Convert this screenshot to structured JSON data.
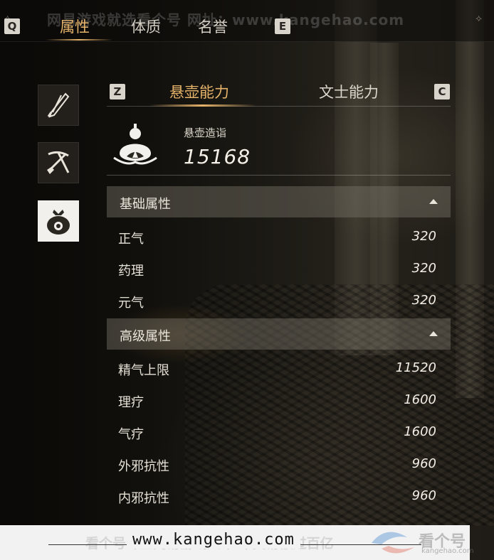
{
  "top_tabs": {
    "left_key": "Q",
    "right_key": "E",
    "items": [
      "属性",
      "体质",
      "名誉"
    ],
    "active_index": 0
  },
  "watermark_top": "网易游戏就选看个号  网址：www.kangehao.com",
  "side_icons": [
    "sword-tool-icon",
    "shovel-pickaxe-icon",
    "pouch-icon"
  ],
  "sub_tabs": {
    "left_key": "Z",
    "right_key": "C",
    "items": [
      "悬壶能力",
      "文士能力"
    ],
    "active_index": 0
  },
  "skill": {
    "label": "悬壶造诣",
    "value": "15168",
    "icon": "gourd-icon"
  },
  "sections": [
    {
      "title": "基础属性",
      "rows": [
        {
          "label": "正气",
          "value": "320"
        },
        {
          "label": "药理",
          "value": "320"
        },
        {
          "label": "元气",
          "value": "320"
        }
      ]
    },
    {
      "title": "高级属性",
      "rows": [
        {
          "label": "精气上限",
          "value": "11520"
        },
        {
          "label": "理疗",
          "value": "1600"
        },
        {
          "label": "气疗",
          "value": "1600"
        },
        {
          "label": "外邪抗性",
          "value": "960"
        },
        {
          "label": "内邪抗性",
          "value": "960"
        }
      ]
    }
  ],
  "bottom_watermark": {
    "url": "www.kangehao.com",
    "ghost_text": "看个号专业网易游戏八年  年交易额过百亿",
    "logo": "看个号",
    "logo_sub": "kangehao.com"
  },
  "colors": {
    "accent": "#e6b36a",
    "panel": "#787369",
    "text": "#e8e2d6"
  }
}
